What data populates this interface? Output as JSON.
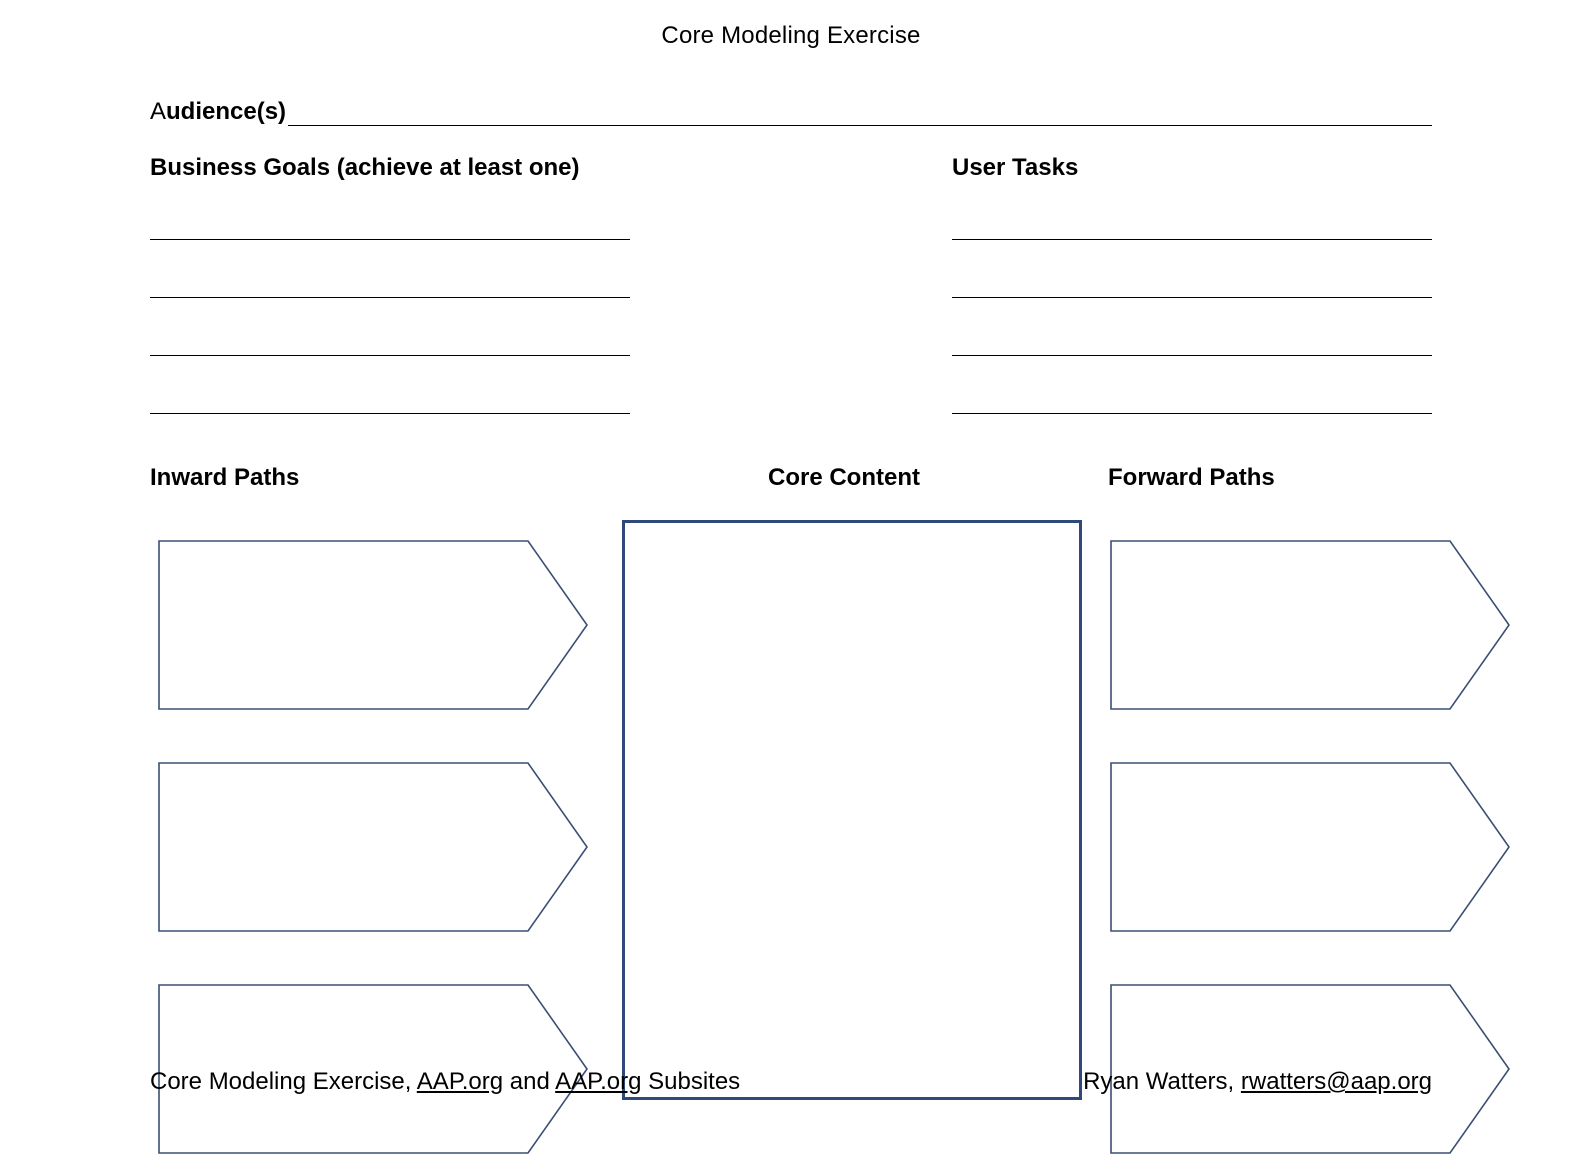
{
  "title": "Core Modeling Exercise",
  "audience": {
    "label_thin": "A",
    "label_bold": "udience(s)",
    "value": ""
  },
  "sections": {
    "business_goals": {
      "heading": "Business Goals (achieve at least one)",
      "lines": [
        "",
        "",
        "",
        ""
      ]
    },
    "user_tasks": {
      "heading": "User Tasks",
      "lines": [
        "",
        "",
        "",
        ""
      ]
    }
  },
  "diagram": {
    "inward_heading": "Inward Paths",
    "core_heading": "Core Content",
    "forward_heading": "Forward Paths",
    "inward_boxes": [
      "",
      "",
      ""
    ],
    "core_content": "",
    "forward_boxes": [
      "",
      "",
      ""
    ],
    "colors": {
      "arrow_stroke": "#3a4f74",
      "core_stroke": "#2f4a7a"
    }
  },
  "footer": {
    "left_prefix": "Core Modeling Exercise, ",
    "left_link1": "AAP.org",
    "left_mid": " and ",
    "left_link2": "AAP.org",
    "left_suffix": " Subsites",
    "right_name": "Ryan Watters, ",
    "right_email": "rwatters@aap.org"
  }
}
